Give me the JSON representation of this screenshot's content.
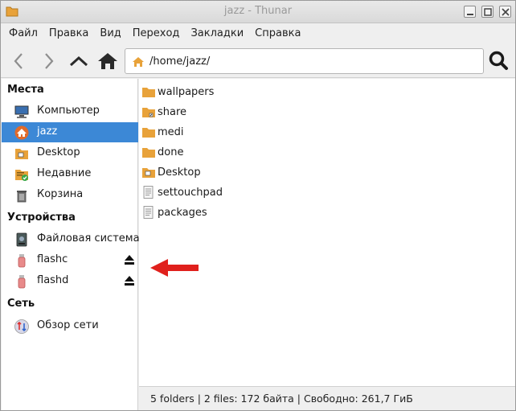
{
  "window": {
    "title": "jazz - Thunar"
  },
  "menubar": {
    "items": [
      "Файл",
      "Правка",
      "Вид",
      "Переход",
      "Закладки",
      "Справка"
    ]
  },
  "toolbar": {
    "location_path": "/home/jazz/"
  },
  "sidebar": {
    "places_title": "Места",
    "places": [
      {
        "label": "Компьютер"
      },
      {
        "label": "jazz"
      },
      {
        "label": "Desktop"
      },
      {
        "label": "Недавние"
      },
      {
        "label": "Корзина"
      }
    ],
    "devices_title": "Устройства",
    "devices": [
      {
        "label": "Файловая система"
      },
      {
        "label": "flashc"
      },
      {
        "label": "flashd"
      }
    ],
    "network_title": "Сеть",
    "network": [
      {
        "label": "Обзор сети"
      }
    ]
  },
  "files": [
    {
      "name": "wallpapers",
      "icon": "folder-icon"
    },
    {
      "name": "share",
      "icon": "folder-link-icon"
    },
    {
      "name": "medi",
      "icon": "folder-icon"
    },
    {
      "name": "done",
      "icon": "folder-icon"
    },
    {
      "name": "Desktop",
      "icon": "desktop-folder-icon"
    },
    {
      "name": "settouchpad",
      "icon": "text-file-icon"
    },
    {
      "name": "packages",
      "icon": "text-file-icon"
    }
  ],
  "statusbar": {
    "text": "5 folders  |  2 files: 172 байта  |  Свободно: 261,7 ГиБ"
  },
  "colors": {
    "selection": "#3c88d6",
    "folder": "#e8a23a",
    "annotation": "#e0201c"
  }
}
